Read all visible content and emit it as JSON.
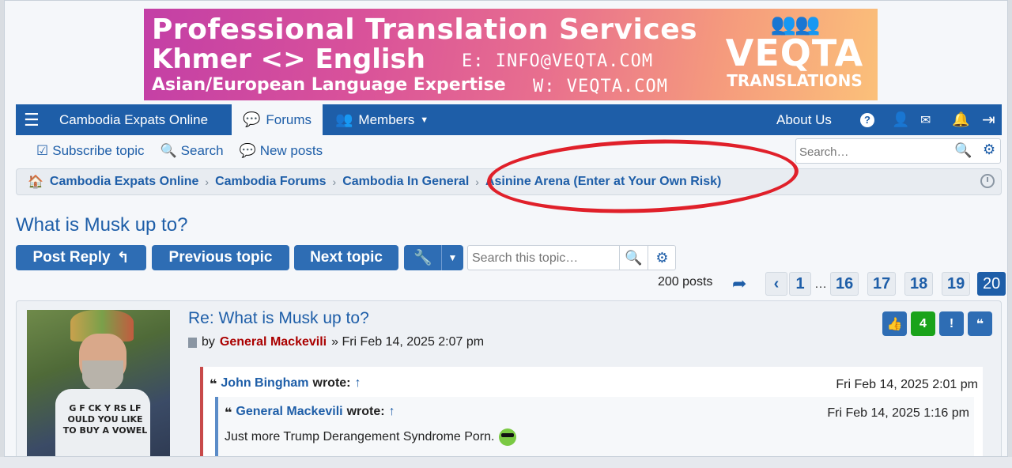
{
  "banner": {
    "line1": "Professional Translation Services",
    "line2": "Khmer <> English",
    "line3": "Asian/European Language Expertise",
    "email": "E: INFO@VEQTA.COM",
    "web": "W: VEQTA.COM",
    "brand": "VEQTA",
    "brand_sub": "TRANSLATIONS"
  },
  "navbar": {
    "site": "Cambodia Expats Online",
    "forums": "Forums",
    "members": "Members",
    "about": "About Us"
  },
  "sublinks": {
    "subscribe": "Subscribe topic",
    "search": "Search",
    "new_posts": "New posts"
  },
  "search": {
    "placeholder": "Search…"
  },
  "breadcrumbs": [
    "Cambodia Expats Online",
    "Cambodia Forums",
    "Cambodia In General",
    "Asinine Arena (Enter at Your Own Risk)"
  ],
  "topic": {
    "title": "What is Musk up to?",
    "post_reply": "Post Reply",
    "previous": "Previous topic",
    "next": "Next topic",
    "search_placeholder": "Search this topic…"
  },
  "pagination": {
    "count": "200 posts",
    "pages": [
      "1",
      "16",
      "17",
      "18",
      "19",
      "20"
    ],
    "ellipsis": "…",
    "current": "20"
  },
  "post": {
    "title": "Re: What is Musk up to?",
    "by": "by",
    "author": "General Mackevili",
    "date": "» Fri Feb 14, 2025 2:07 pm",
    "reactions": "4",
    "shirt_text": "G F CK Y RS LF OULD YOU LIKE TO BUY A VOWEL",
    "quote1": {
      "author": "John Bingham",
      "wrote": "wrote:",
      "arrow": "↑",
      "date": "Fri Feb 14, 2025 2:01 pm"
    },
    "quote2": {
      "author": "General Mackevili",
      "wrote": "wrote:",
      "arrow": "↑",
      "date": "Fri Feb 14, 2025 1:16 pm",
      "body": "Just more Trump Derangement Syndrome Porn."
    }
  }
}
